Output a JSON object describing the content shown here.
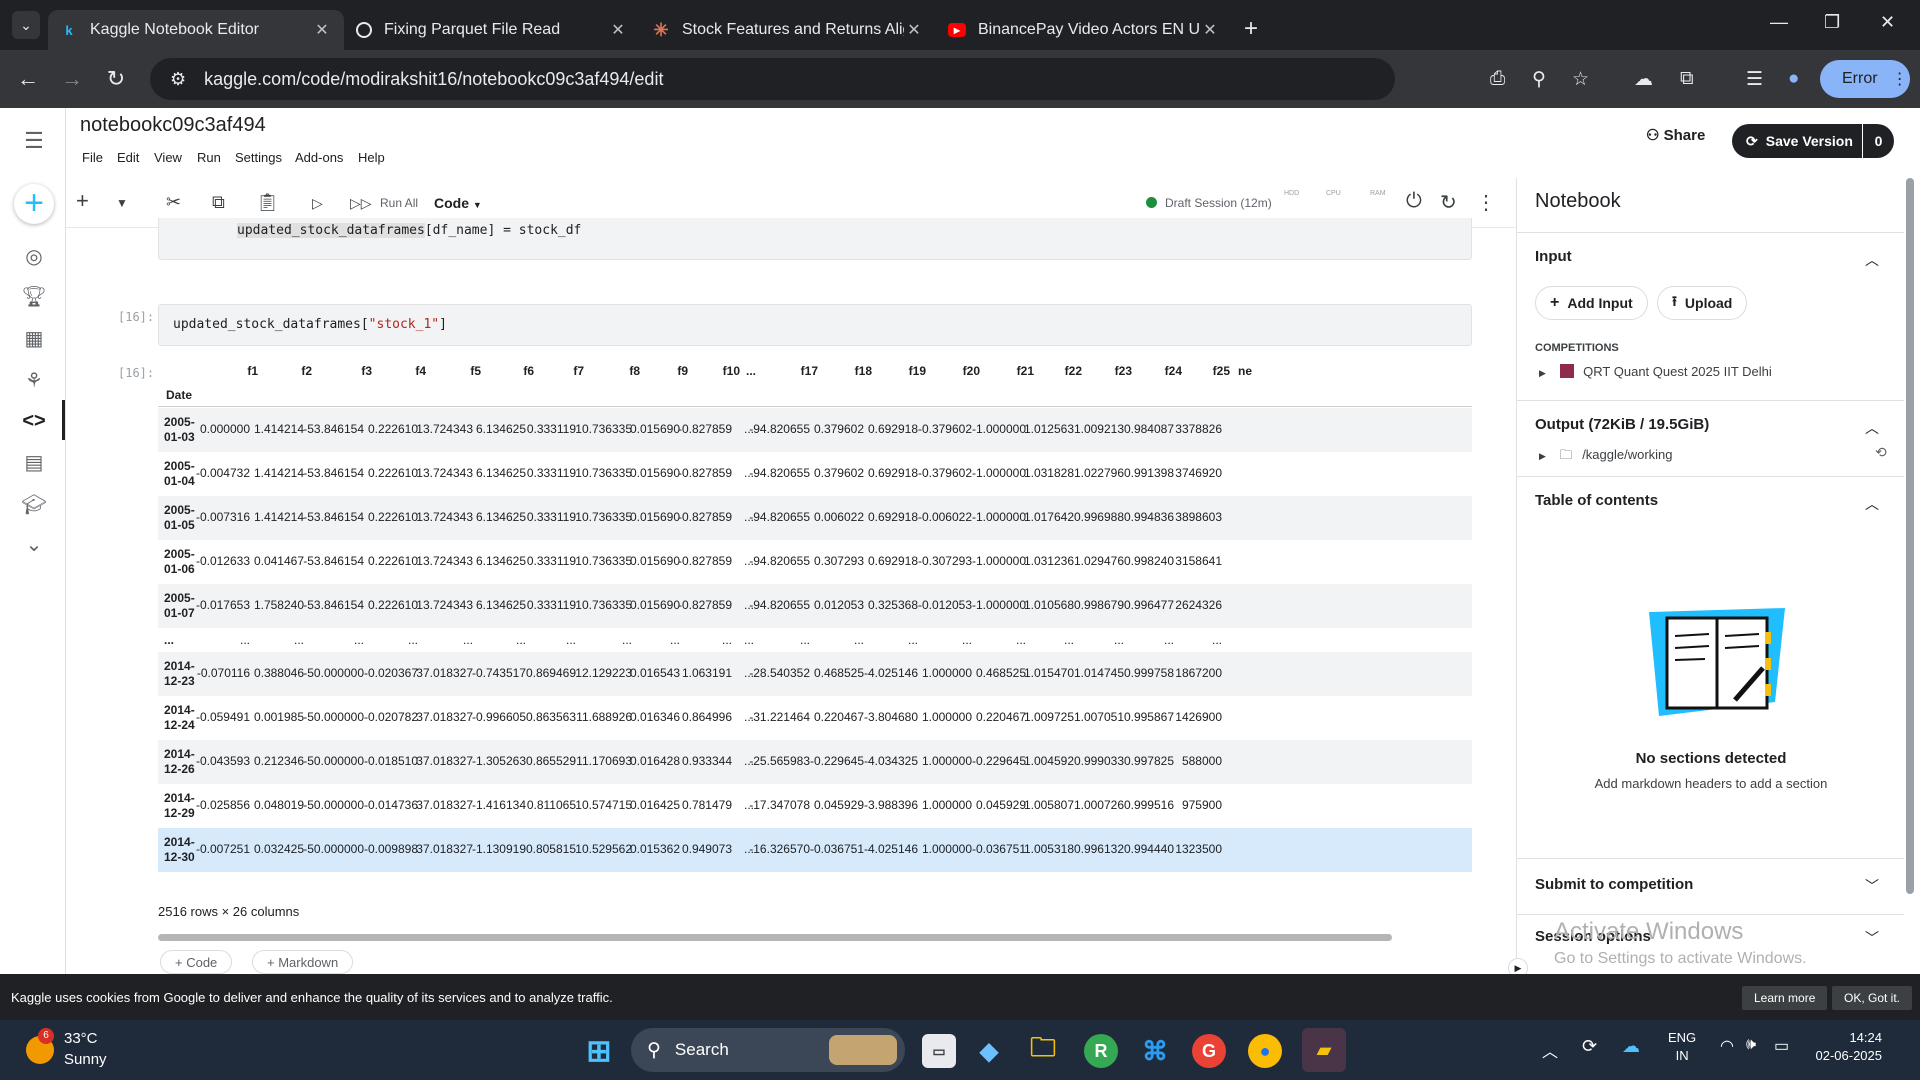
{
  "browser": {
    "tabs": [
      {
        "title": "Kaggle Notebook Editor",
        "active": true,
        "icon": "kaggle-k-icon"
      },
      {
        "title": "Fixing Parquet File Read",
        "active": false,
        "icon": "openai-icon"
      },
      {
        "title": "Stock Features and Returns Alig",
        "active": false,
        "icon": "claude-icon"
      },
      {
        "title": "BinancePay Video Actors EN UA",
        "active": false,
        "icon": "youtube-icon"
      }
    ],
    "url": "kaggle.com/code/modirakshit16/notebookc09c3af494/edit",
    "profile_button": "Error"
  },
  "notebook": {
    "title": "notebookc09c3af494",
    "menu": [
      "File",
      "Edit",
      "View",
      "Run",
      "Settings",
      "Add-ons",
      "Help"
    ],
    "share_label": "Share",
    "save_label": "Save Version",
    "save_count": "0",
    "run_all_label": "Run All",
    "cell_type": "Code",
    "session_status": "Draft Session (12m)",
    "meters": [
      "HDD",
      "CPU",
      "RAM"
    ]
  },
  "cells": {
    "prev_code": "updated_stock_dataframes[df_name] = stock_df",
    "prev_code_hl": "updated_stock_dataframes",
    "prev_code_rest": "[df_name] = stock_df",
    "cell16_prompt": "[16]:",
    "cell16_code_a": "updated_stock_dataframes[",
    "cell16_code_str": "\"stock_1\"",
    "cell16_code_b": "]",
    "out16_prompt": "[16]:",
    "index_name": "Date",
    "columns": [
      "f1",
      "f2",
      "f3",
      "f4",
      "f5",
      "f6",
      "f7",
      "f8",
      "f9",
      "f10",
      "...",
      "f17",
      "f18",
      "f19",
      "f20",
      "f21",
      "f22",
      "f23",
      "f24",
      "f25",
      "ne"
    ],
    "rows": [
      {
        "date": [
          "2005-",
          "01-03"
        ],
        "values": [
          "0.000000",
          "1.414214",
          "-53.846154",
          "0.222610",
          "13.724343",
          "6.134625",
          "0.333119",
          "10.736335",
          "0.015690",
          "-0.827859",
          "...",
          "-94.820655",
          "0.379602",
          "0.692918",
          "-0.379602",
          "-1.000000",
          "1.012563",
          "1.009213",
          "0.984087",
          "3378826"
        ]
      },
      {
        "date": [
          "2005-",
          "01-04"
        ],
        "values": [
          "-0.004732",
          "1.414214",
          "-53.846154",
          "0.222610",
          "13.724343",
          "6.134625",
          "0.333119",
          "10.736335",
          "0.015690",
          "-0.827859",
          "...",
          "-94.820655",
          "0.379602",
          "0.692918",
          "-0.379602",
          "-1.000000",
          "1.031828",
          "1.022796",
          "0.991398",
          "3746920"
        ]
      },
      {
        "date": [
          "2005-",
          "01-05"
        ],
        "values": [
          "-0.007316",
          "1.414214",
          "-53.846154",
          "0.222610",
          "13.724343",
          "6.134625",
          "0.333119",
          "10.736335",
          "0.015690",
          "-0.827859",
          "...",
          "-94.820655",
          "0.006022",
          "0.692918",
          "-0.006022",
          "-1.000000",
          "1.017642",
          "0.996988",
          "0.994836",
          "3898603"
        ]
      },
      {
        "date": [
          "2005-",
          "01-06"
        ],
        "values": [
          "-0.012633",
          "0.041467",
          "-53.846154",
          "0.222610",
          "13.724343",
          "6.134625",
          "0.333119",
          "10.736335",
          "0.015690",
          "-0.827859",
          "...",
          "-94.820655",
          "0.307293",
          "0.692918",
          "-0.307293",
          "-1.000000",
          "1.031236",
          "1.029476",
          "0.998240",
          "3158641"
        ]
      },
      {
        "date": [
          "2005-",
          "01-07"
        ],
        "values": [
          "-0.017653",
          "1.758240",
          "-53.846154",
          "0.222610",
          "13.724343",
          "6.134625",
          "0.333119",
          "10.736335",
          "0.015690",
          "-0.827859",
          "...",
          "-94.820655",
          "0.012053",
          "0.325368",
          "-0.012053",
          "-1.000000",
          "1.010568",
          "0.998679",
          "0.996477",
          "2624326"
        ]
      },
      {
        "date": [
          "...",
          ""
        ],
        "values": [
          "...",
          "...",
          "...",
          "...",
          "...",
          "...",
          "...",
          "...",
          "...",
          "...",
          "...",
          "...",
          "...",
          "...",
          "...",
          "...",
          "...",
          "...",
          "...",
          "..."
        ]
      },
      {
        "date": [
          "2014-",
          "12-23"
        ],
        "values": [
          "-0.070116",
          "0.388046",
          "-50.000000",
          "-0.020367",
          "37.018327",
          "-0.743517",
          "0.869469",
          "12.129223",
          "0.016543",
          "1.063191",
          "...",
          "-28.540352",
          "0.468525",
          "-4.025146",
          "1.000000",
          "0.468525",
          "1.015470",
          "1.014745",
          "0.999758",
          "1867200"
        ]
      },
      {
        "date": [
          "2014-",
          "12-24"
        ],
        "values": [
          "-0.059491",
          "0.001985",
          "-50.000000",
          "-0.020782",
          "37.018327",
          "-0.996605",
          "0.863563",
          "11.688926",
          "0.016346",
          "0.864996",
          "...",
          "-31.221464",
          "0.220467",
          "-3.804680",
          "1.000000",
          "0.220467",
          "1.009725",
          "1.007051",
          "0.995867",
          "1426900"
        ]
      },
      {
        "date": [
          "2014-",
          "12-26"
        ],
        "values": [
          "-0.043593",
          "0.212346",
          "-50.000000",
          "-0.018510",
          "37.018327",
          "-1.305263",
          "0.865529",
          "11.170693",
          "0.016428",
          "0.933344",
          "...",
          "-25.565983",
          "-0.229645",
          "-4.034325",
          "1.000000",
          "-0.229645",
          "1.004592",
          "0.999033",
          "0.997825",
          "588000"
        ]
      },
      {
        "date": [
          "2014-",
          "12-29"
        ],
        "values": [
          "-0.025856",
          "0.048019",
          "-50.000000",
          "-0.014736",
          "37.018327",
          "-1.416134",
          "0.811065",
          "10.574715",
          "0.016425",
          "0.781479",
          "...",
          "-17.347078",
          "0.045929",
          "-3.988396",
          "1.000000",
          "0.045929",
          "1.005807",
          "1.000726",
          "0.999516",
          "975900"
        ]
      },
      {
        "date": [
          "2014-",
          "12-30"
        ],
        "values": [
          "-0.007251",
          "0.032425",
          "-50.000000",
          "-0.009898",
          "37.018327",
          "-1.130919",
          "0.805815",
          "10.529562",
          "0.015362",
          "0.949073",
          "...",
          "-16.326570",
          "-0.036751",
          "-4.025146",
          "1.000000",
          "-0.036751",
          "1.005318",
          "0.996132",
          "0.994440",
          "1323500"
        ]
      }
    ],
    "shape": "2516 rows × 26 columns",
    "add_code": "+ Code",
    "add_markdown": "+ Markdown"
  },
  "panel": {
    "title": "Notebook",
    "input_title": "Input",
    "add_input": "Add Input",
    "upload": "Upload",
    "competitions_label": "COMPETITIONS",
    "competition_name": "QRT Quant Quest 2025 IIT Delhi",
    "output_title": "Output (72KiB / 19.5GiB)",
    "output_path": "/kaggle/working",
    "toc_title": "Table of contents",
    "no_sections": "No sections detected",
    "no_sections_hint": "Add markdown headers to add a section",
    "submit_title": "Submit to competition",
    "session_title": "Session options"
  },
  "cookie": {
    "text": "Kaggle uses cookies from Google to deliver and enhance the quality of its services and to analyze traffic.",
    "learn_more": "Learn more",
    "ok": "OK, Got it."
  },
  "watermark": {
    "line1": "Activate Windows",
    "line2": "Go to Settings to activate Windows."
  },
  "taskbar": {
    "weather_badge": "6",
    "temp": "33°C",
    "condition": "Sunny",
    "search": "Search",
    "lang1": "ENG",
    "lang2": "IN",
    "time": "14:24",
    "date": "02-06-2025"
  },
  "colors": {
    "kaggle_blue": "#20beff",
    "accent_green": "#1e8e3e",
    "row_highlight": "#d6eafc"
  }
}
